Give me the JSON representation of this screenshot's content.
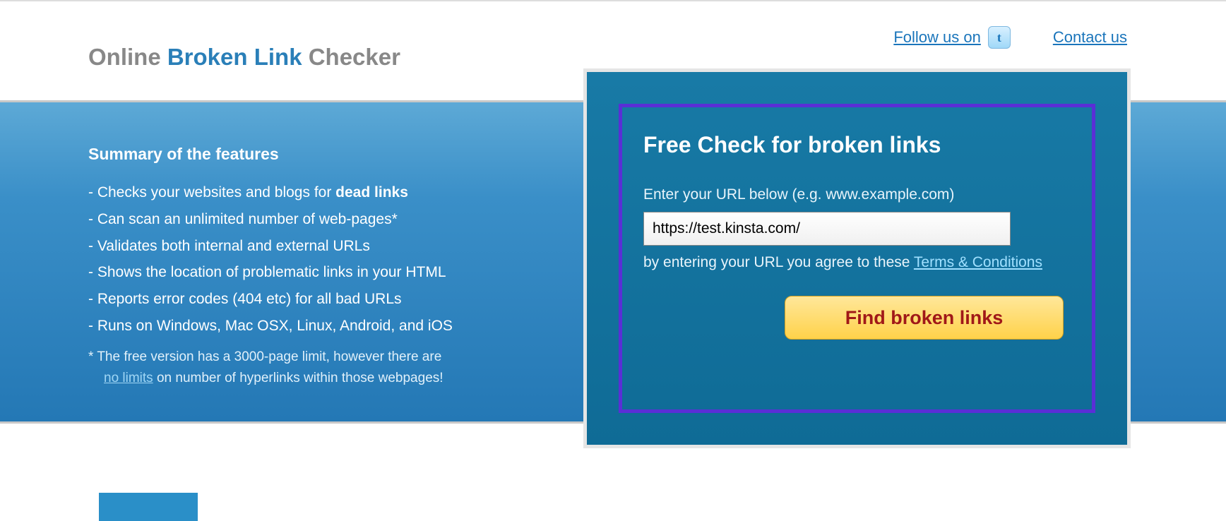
{
  "header": {
    "logo_part1": "Online ",
    "logo_part2": "Broken Link",
    "logo_part3": " Checker",
    "follow_us": "Follow us on",
    "twitter_glyph": "t",
    "contact": "Contact us"
  },
  "features": {
    "title": "Summary of the features",
    "items": [
      {
        "pre": "- Checks your websites and blogs for ",
        "bold": "dead links",
        "post": ""
      },
      {
        "pre": "- Can scan an unlimited number of web-pages*",
        "bold": "",
        "post": ""
      },
      {
        "pre": "- Validates both internal and external URLs",
        "bold": "",
        "post": ""
      },
      {
        "pre": "- Shows the location of problematic links in your HTML",
        "bold": "",
        "post": ""
      },
      {
        "pre": "- Reports error codes (404 etc) for all bad URLs",
        "bold": "",
        "post": ""
      },
      {
        "pre": "- Runs on Windows, Mac OSX, Linux, Android, and iOS",
        "bold": "",
        "post": ""
      }
    ],
    "footnote_pre": "*  The free version has a 3000-page limit, however there are",
    "footnote_link": "no limits",
    "footnote_post": " on number of hyperlinks within those webpages!"
  },
  "form": {
    "title": "Free Check for broken links",
    "label": "Enter your URL below (e.g. www.example.com)",
    "url_value": "https://test.kinsta.com/",
    "terms_pre": "by entering your URL you agree to these ",
    "terms_link": "Terms & Conditions",
    "button": "Find broken links"
  }
}
